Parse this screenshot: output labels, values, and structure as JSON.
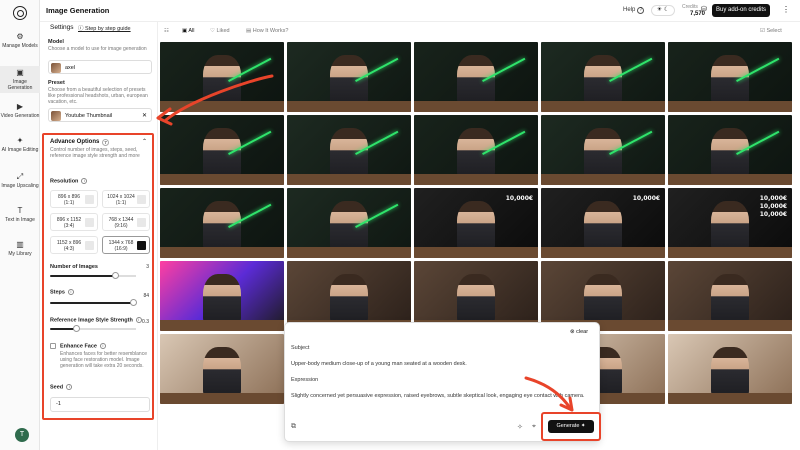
{
  "nav": {
    "items": [
      {
        "label": "Manage Models",
        "icon": "cube-icon"
      },
      {
        "label": "Image Generation",
        "icon": "image-icon"
      },
      {
        "label": "Video Generation",
        "icon": "video-icon"
      },
      {
        "label": "AI Image Editing",
        "icon": "wand-icon"
      },
      {
        "label": "Image Upscaling",
        "icon": "upscale-icon"
      },
      {
        "label": "Text in Image",
        "icon": "text-icon"
      },
      {
        "label": "My Library",
        "icon": "library-icon"
      }
    ],
    "avatar_initial": "T"
  },
  "header": {
    "title": "Image Generation",
    "help": "Help",
    "credits_label": "Credits",
    "credits_value": "7,570",
    "buy_label": "Buy add-on credits"
  },
  "settings": {
    "title": "Settings",
    "guide": "Step by step guide",
    "model_label": "Model",
    "model_desc": "Choose a model to use for image generation",
    "model_value": "axel",
    "preset_label": "Preset",
    "preset_desc": "Choose from a beautiful selection of presets like professional headshots, urban, european vacation, etc.",
    "preset_value": "Youtube Thumbnail"
  },
  "advanced": {
    "title": "Advance Options",
    "badge": "7",
    "desc": "Control number of images, steps, seed, reference image style strength and more",
    "resolution_label": "Resolution",
    "resolutions": [
      {
        "size": "896 x 896",
        "ratio": "(1:1)"
      },
      {
        "size": "1024 x 1024",
        "ratio": "(1:1)"
      },
      {
        "size": "896 x 1152",
        "ratio": "(3:4)"
      },
      {
        "size": "768 x 1344",
        "ratio": "(9:16)"
      },
      {
        "size": "1152 x 896",
        "ratio": "(4:3)"
      },
      {
        "size": "1344 x 768",
        "ratio": "(16:9)"
      }
    ],
    "num_images_label": "Number of Images",
    "num_images_value": "3",
    "num_images_fraction": 0.75,
    "steps_label": "Steps",
    "steps_value": "84",
    "steps_fraction": 0.97,
    "strength_label": "Reference Image Style Strength",
    "strength_value": "0.3",
    "strength_fraction": 0.3,
    "enhance_label": "Enhance Face",
    "enhance_desc": "Enhances faces for better resemblance using face restoration model. Image generation will take extra 20 seconds.",
    "seed_label": "Seed",
    "seed_value": "-1"
  },
  "gallery": {
    "tab_all": "All",
    "tab_liked": "Liked",
    "tab_how": "How It Works?",
    "select": "Select",
    "money_texts": [
      "10,000€",
      "10,000€",
      "10,0000€",
      "10,000€\n10,000€\n10,000€"
    ]
  },
  "prompt": {
    "clear": "clear",
    "subject_label": "Subject",
    "subject_text": "Upper-body medium close-up of a young man seated at a wooden desk.",
    "expression_label": "Expression",
    "expression_text": "Slightly concerned yet persuasive expression, raised eyebrows, subtle skeptical look, engaging eye contact with camera.",
    "generate": "Generate"
  },
  "colors": {
    "accent_red": "#e8442a",
    "chart_green": "#2fe36b"
  }
}
